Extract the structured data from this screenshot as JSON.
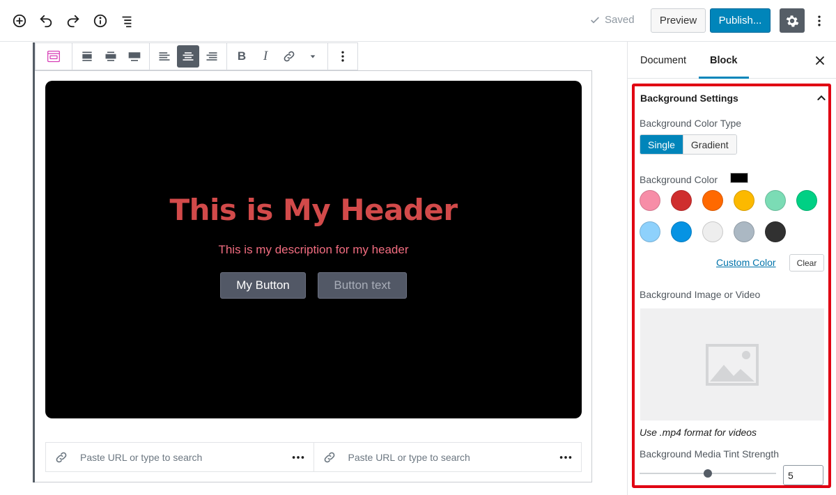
{
  "topbar": {
    "saved_label": "Saved",
    "preview_label": "Preview",
    "publish_label": "Publish..."
  },
  "editor": {
    "hero": {
      "title": "This is My Header",
      "description": "This is my description for my header",
      "button1": "My Button",
      "button2": "Button text",
      "background_color": "#000000",
      "title_color": "#d24a4a",
      "description_color": "#f26d80"
    },
    "url_inputs": [
      {
        "placeholder": "Paste URL or type to search"
      },
      {
        "placeholder": "Paste URL or type to search"
      }
    ]
  },
  "sidebar": {
    "tabs": [
      {
        "label": "Document",
        "active": false
      },
      {
        "label": "Block",
        "active": true
      }
    ],
    "panel": {
      "title": "Background Settings",
      "color_type_label": "Background Color Type",
      "color_type_options": [
        "Single",
        "Gradient"
      ],
      "color_type_selected": "Single",
      "bg_color_label": "Background Color",
      "bg_color_value": "#000000",
      "swatches": [
        "#f78da7",
        "#cf2e2e",
        "#ff6900",
        "#fcb900",
        "#7bdcb5",
        "#00d084",
        "#8ed1fc",
        "#0693e3",
        "#eeeeee",
        "#abb8c3",
        "#313131"
      ],
      "custom_color_label": "Custom Color",
      "clear_label": "Clear",
      "media_label": "Background Image or Video",
      "media_hint": "Use .mp4 format for videos",
      "tint_label": "Background Media Tint Strength",
      "tint_value": "5",
      "tint_fraction": 0.5
    }
  }
}
